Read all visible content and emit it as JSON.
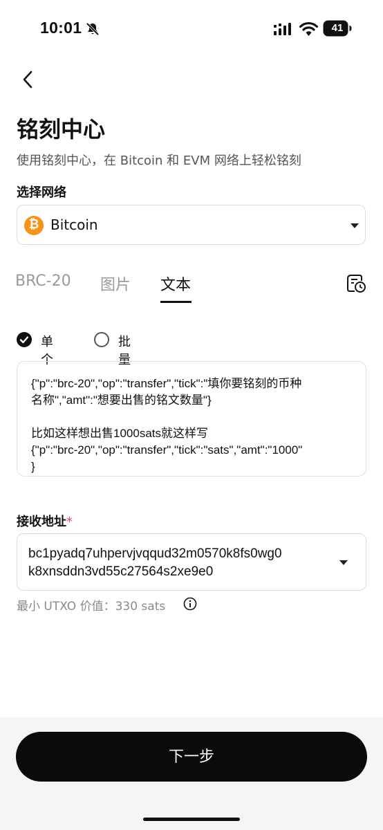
{
  "status_bar": {
    "time": "10:01",
    "battery": "41"
  },
  "header": {
    "title": "铭刻中心",
    "subtitle": "使用铭刻中心，在 Bitcoin 和 EVM 网络上轻松铭刻"
  },
  "network": {
    "label": "选择网络",
    "value": "Bitcoin",
    "icon_color": "#F7931A"
  },
  "tabs": [
    {
      "label": "BRC-20",
      "active": false
    },
    {
      "label": "图片",
      "active": false
    },
    {
      "label": "文本",
      "active": true
    }
  ],
  "mode": {
    "single": "单个",
    "batch": "批量",
    "selected": "single"
  },
  "text_input": {
    "lines": [
      "{\"p\":\"brc-20\",\"op\":\"transfer\",\"tick\":\"填你要铭刻的币种",
      "名称\",\"amt\":\"想要出售的铭文数量\"}",
      "",
      "比如这样想出售1000sats就这样写",
      "{\"p\":\"brc-20\",\"op\":\"transfer\",\"tick\":\"sats\",\"amt\":\"1000\"",
      "}"
    ]
  },
  "address": {
    "label": "接收地址",
    "required_mark": "*",
    "value_line1": "bc1pyadq7uhpervjvqqud32m0570k8fs0wg0",
    "value_line2": "k8xnsddn3vd55c27564s2xe9e0"
  },
  "min_utxo": "最小 UTXO 价值：330 sats",
  "footer": {
    "next_label": "下一步"
  }
}
